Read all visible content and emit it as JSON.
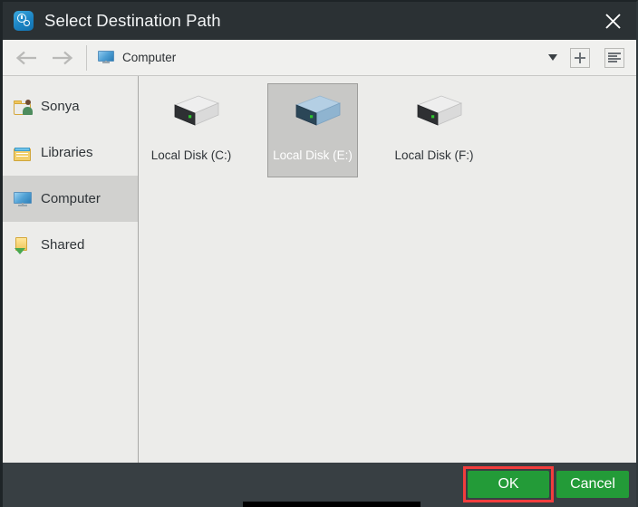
{
  "window": {
    "title": "Select Destination Path",
    "app_icon": "search-clock-icon",
    "close_icon": "close-icon"
  },
  "toolbar": {
    "back_icon": "arrow-left-icon",
    "forward_icon": "arrow-right-icon",
    "path_icon": "monitor-icon",
    "path_text": "Computer",
    "dropdown_icon": "chevron-down-icon",
    "new_folder_icon": "plus-icon",
    "view_list_icon": "list-view-icon"
  },
  "sidebar": {
    "items": [
      {
        "label": "Sonya",
        "icon": "user-folder-icon",
        "selected": false
      },
      {
        "label": "Libraries",
        "icon": "libraries-icon",
        "selected": false
      },
      {
        "label": "Computer",
        "icon": "monitor-icon",
        "selected": true
      },
      {
        "label": "Shared",
        "icon": "shared-folder-icon",
        "selected": false
      }
    ]
  },
  "content": {
    "items": [
      {
        "label": "Local Disk (C:)",
        "icon": "hard-drive-icon",
        "selected": false
      },
      {
        "label": "Local Disk (E:)",
        "icon": "hard-drive-icon",
        "selected": true
      },
      {
        "label": "Local Disk (F:)",
        "icon": "hard-drive-icon",
        "selected": false
      }
    ]
  },
  "footer": {
    "ok_label": "OK",
    "cancel_label": "Cancel"
  },
  "colors": {
    "titlebar_bg": "#2b3134",
    "footer_bg": "#383f43",
    "button_green": "#239b38",
    "highlight_red": "#f23d3d",
    "selection_gray": "#c8c8c6",
    "pane_bg": "#ececea"
  }
}
